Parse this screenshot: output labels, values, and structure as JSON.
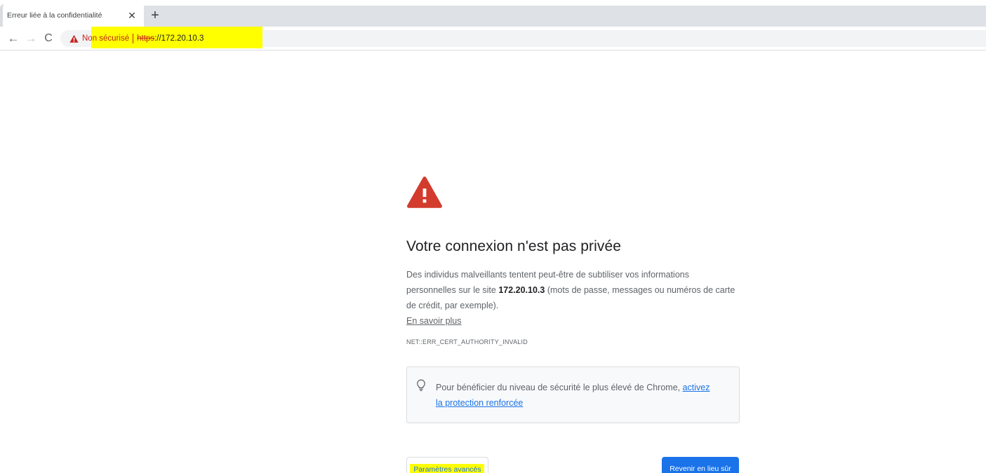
{
  "tab": {
    "title": "Erreur liée à la confidentialité",
    "close_glyph": "✕",
    "new_tab_glyph": "+"
  },
  "toolbar": {
    "back_glyph": "←",
    "forward_glyph": "→",
    "reload_glyph": "C"
  },
  "omnibox": {
    "security_label": "Non sécurisé",
    "url_scheme": "https",
    "url_rest": "://172.20.10.3",
    "security_icon": "warning-triangle-icon"
  },
  "interstitial": {
    "warning_icon": "warning-triangle-icon",
    "heading": "Votre connexion n'est pas privée",
    "body_before": "Des individus malveillants tentent peut-être de subtiliser vos informations personnelles sur le site ",
    "body_host": "172.20.10.3",
    "body_after": " (mots de passe, messages ou numéros de carte de crédit, par exemple).",
    "learn_more": "En savoir plus",
    "error_code": "NET::ERR_CERT_AUTHORITY_INVALID",
    "enhanced_text": "Pour bénéficier du niveau de sécurité le plus élevé de Chrome, ",
    "enhanced_link": "activez la protection renforcée",
    "enhanced_icon": "lightbulb-icon",
    "advanced_button": "Paramètres avancés",
    "back_button": "Revenir en lieu sûr"
  },
  "colors": {
    "warning_red": "#c5221f",
    "accent_blue": "#1a73e8",
    "highlight_yellow": "#ffff00"
  }
}
